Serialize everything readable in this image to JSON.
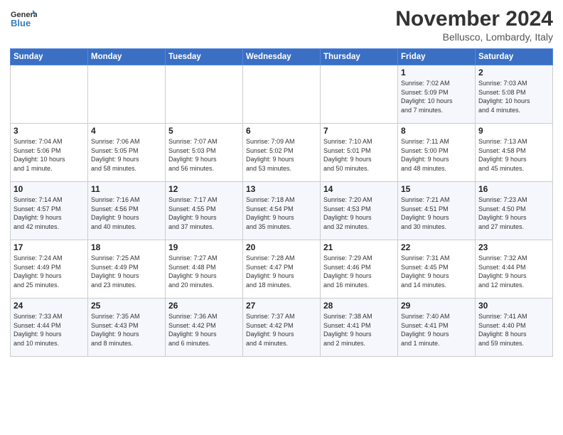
{
  "header": {
    "logo_line1": "General",
    "logo_line2": "Blue",
    "month": "November 2024",
    "location": "Bellusco, Lombardy, Italy"
  },
  "weekdays": [
    "Sunday",
    "Monday",
    "Tuesday",
    "Wednesday",
    "Thursday",
    "Friday",
    "Saturday"
  ],
  "weeks": [
    [
      {
        "day": "",
        "info": ""
      },
      {
        "day": "",
        "info": ""
      },
      {
        "day": "",
        "info": ""
      },
      {
        "day": "",
        "info": ""
      },
      {
        "day": "",
        "info": ""
      },
      {
        "day": "1",
        "info": "Sunrise: 7:02 AM\nSunset: 5:09 PM\nDaylight: 10 hours\nand 7 minutes."
      },
      {
        "day": "2",
        "info": "Sunrise: 7:03 AM\nSunset: 5:08 PM\nDaylight: 10 hours\nand 4 minutes."
      }
    ],
    [
      {
        "day": "3",
        "info": "Sunrise: 7:04 AM\nSunset: 5:06 PM\nDaylight: 10 hours\nand 1 minute."
      },
      {
        "day": "4",
        "info": "Sunrise: 7:06 AM\nSunset: 5:05 PM\nDaylight: 9 hours\nand 58 minutes."
      },
      {
        "day": "5",
        "info": "Sunrise: 7:07 AM\nSunset: 5:03 PM\nDaylight: 9 hours\nand 56 minutes."
      },
      {
        "day": "6",
        "info": "Sunrise: 7:09 AM\nSunset: 5:02 PM\nDaylight: 9 hours\nand 53 minutes."
      },
      {
        "day": "7",
        "info": "Sunrise: 7:10 AM\nSunset: 5:01 PM\nDaylight: 9 hours\nand 50 minutes."
      },
      {
        "day": "8",
        "info": "Sunrise: 7:11 AM\nSunset: 5:00 PM\nDaylight: 9 hours\nand 48 minutes."
      },
      {
        "day": "9",
        "info": "Sunrise: 7:13 AM\nSunset: 4:58 PM\nDaylight: 9 hours\nand 45 minutes."
      }
    ],
    [
      {
        "day": "10",
        "info": "Sunrise: 7:14 AM\nSunset: 4:57 PM\nDaylight: 9 hours\nand 42 minutes."
      },
      {
        "day": "11",
        "info": "Sunrise: 7:16 AM\nSunset: 4:56 PM\nDaylight: 9 hours\nand 40 minutes."
      },
      {
        "day": "12",
        "info": "Sunrise: 7:17 AM\nSunset: 4:55 PM\nDaylight: 9 hours\nand 37 minutes."
      },
      {
        "day": "13",
        "info": "Sunrise: 7:18 AM\nSunset: 4:54 PM\nDaylight: 9 hours\nand 35 minutes."
      },
      {
        "day": "14",
        "info": "Sunrise: 7:20 AM\nSunset: 4:53 PM\nDaylight: 9 hours\nand 32 minutes."
      },
      {
        "day": "15",
        "info": "Sunrise: 7:21 AM\nSunset: 4:51 PM\nDaylight: 9 hours\nand 30 minutes."
      },
      {
        "day": "16",
        "info": "Sunrise: 7:23 AM\nSunset: 4:50 PM\nDaylight: 9 hours\nand 27 minutes."
      }
    ],
    [
      {
        "day": "17",
        "info": "Sunrise: 7:24 AM\nSunset: 4:49 PM\nDaylight: 9 hours\nand 25 minutes."
      },
      {
        "day": "18",
        "info": "Sunrise: 7:25 AM\nSunset: 4:49 PM\nDaylight: 9 hours\nand 23 minutes."
      },
      {
        "day": "19",
        "info": "Sunrise: 7:27 AM\nSunset: 4:48 PM\nDaylight: 9 hours\nand 20 minutes."
      },
      {
        "day": "20",
        "info": "Sunrise: 7:28 AM\nSunset: 4:47 PM\nDaylight: 9 hours\nand 18 minutes."
      },
      {
        "day": "21",
        "info": "Sunrise: 7:29 AM\nSunset: 4:46 PM\nDaylight: 9 hours\nand 16 minutes."
      },
      {
        "day": "22",
        "info": "Sunrise: 7:31 AM\nSunset: 4:45 PM\nDaylight: 9 hours\nand 14 minutes."
      },
      {
        "day": "23",
        "info": "Sunrise: 7:32 AM\nSunset: 4:44 PM\nDaylight: 9 hours\nand 12 minutes."
      }
    ],
    [
      {
        "day": "24",
        "info": "Sunrise: 7:33 AM\nSunset: 4:44 PM\nDaylight: 9 hours\nand 10 minutes."
      },
      {
        "day": "25",
        "info": "Sunrise: 7:35 AM\nSunset: 4:43 PM\nDaylight: 9 hours\nand 8 minutes."
      },
      {
        "day": "26",
        "info": "Sunrise: 7:36 AM\nSunset: 4:42 PM\nDaylight: 9 hours\nand 6 minutes."
      },
      {
        "day": "27",
        "info": "Sunrise: 7:37 AM\nSunset: 4:42 PM\nDaylight: 9 hours\nand 4 minutes."
      },
      {
        "day": "28",
        "info": "Sunrise: 7:38 AM\nSunset: 4:41 PM\nDaylight: 9 hours\nand 2 minutes."
      },
      {
        "day": "29",
        "info": "Sunrise: 7:40 AM\nSunset: 4:41 PM\nDaylight: 9 hours\nand 1 minute."
      },
      {
        "day": "30",
        "info": "Sunrise: 7:41 AM\nSunset: 4:40 PM\nDaylight: 8 hours\nand 59 minutes."
      }
    ]
  ]
}
